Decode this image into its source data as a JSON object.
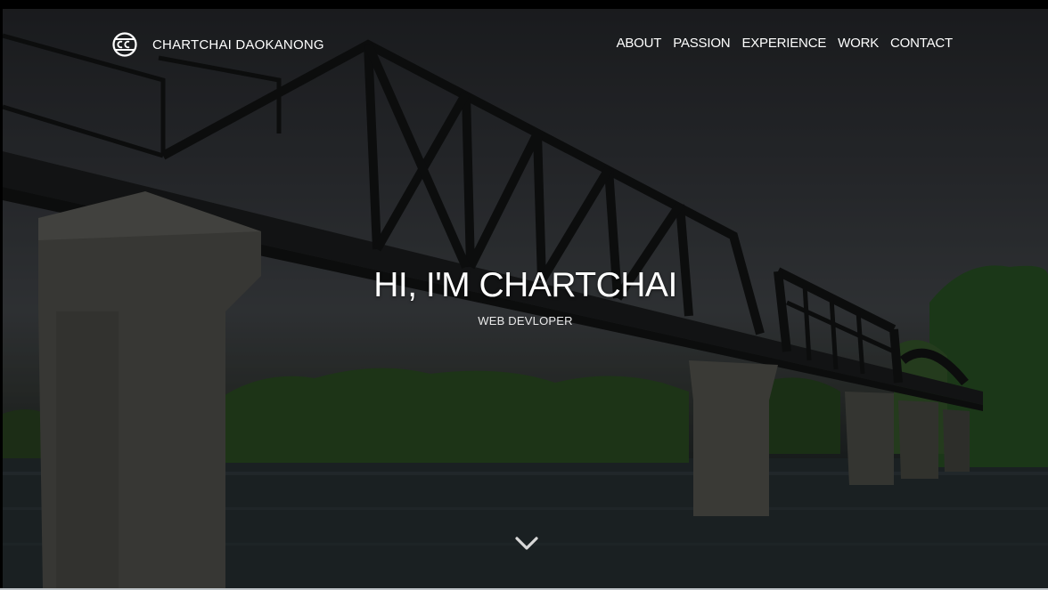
{
  "site": {
    "brand_name": "CHARTCHAI DAOKANONG",
    "logo_icon": "cc-logo-icon"
  },
  "nav": {
    "items": [
      {
        "label": "ABOUT"
      },
      {
        "label": "PASSION"
      },
      {
        "label": "EXPERIENCE"
      },
      {
        "label": "WORK"
      },
      {
        "label": "CONTACT"
      }
    ]
  },
  "hero": {
    "headline": "HI, I'M CHARTCHAI",
    "tagline": "WEB DEVLOPER",
    "scroll_icon": "chevron-down-icon",
    "background_image": "bridge-over-river-photo"
  },
  "colors": {
    "text": "#ffffff",
    "overlay": "#000000"
  }
}
